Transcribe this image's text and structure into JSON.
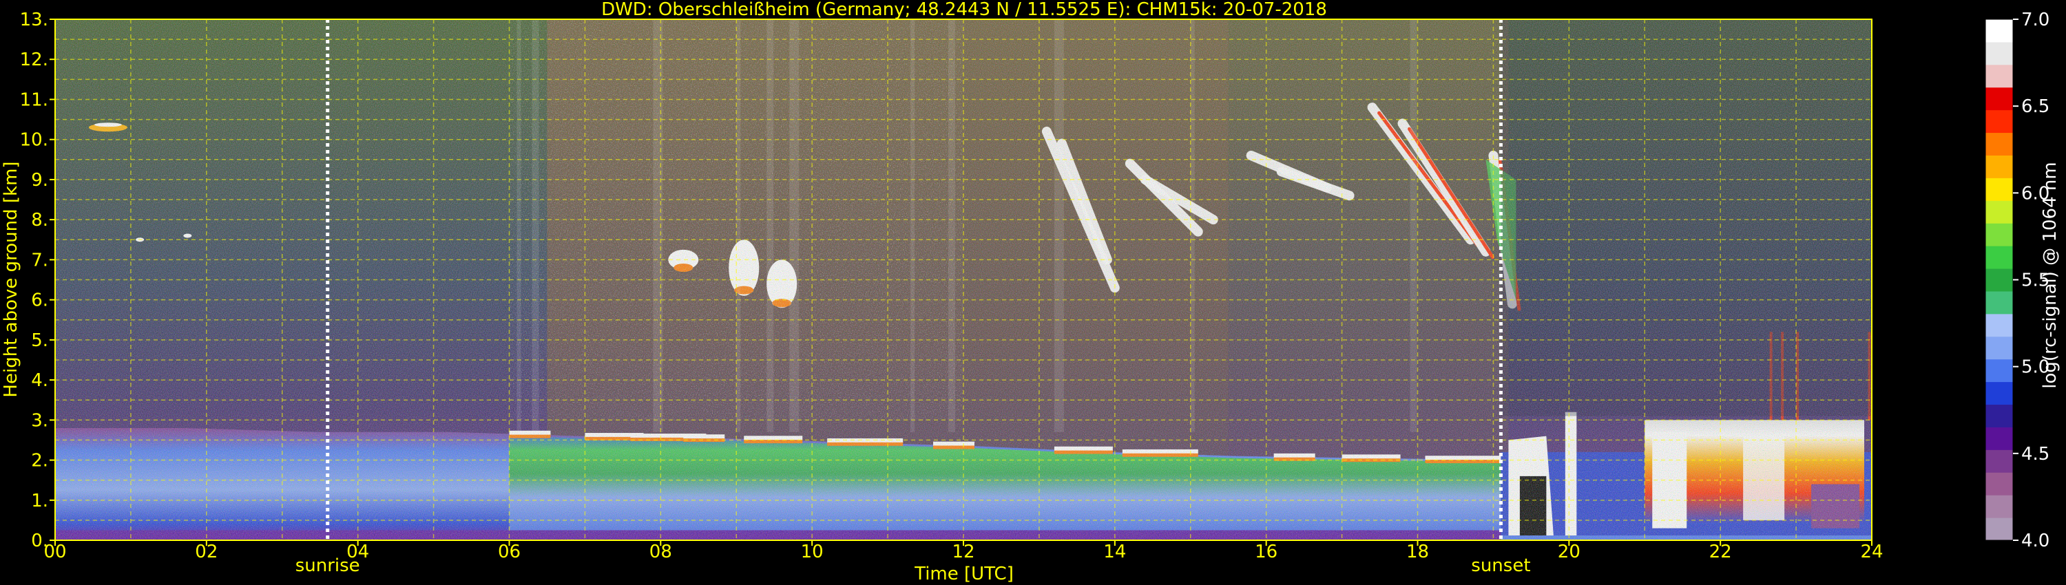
{
  "chart_data": {
    "type": "heatmap",
    "title": "DWD: Oberschleißheim (Germany; 48.2443 N / 11.5525 E):    CHM15k: 20-07-2018",
    "xlabel": "Time [UTC]",
    "ylabel": "Height above ground [km]",
    "xlim": [
      0,
      24
    ],
    "ylim": [
      0,
      13
    ],
    "x_ticks": [
      "00",
      "02",
      "04",
      "06",
      "08",
      "10",
      "12",
      "14",
      "16",
      "18",
      "20",
      "22",
      "24"
    ],
    "y_ticks": [
      "0.",
      "1.",
      "2.",
      "3.",
      "4.",
      "5.",
      "6.",
      "7.",
      "8.",
      "9.",
      "10.",
      "11.",
      "12.",
      "13."
    ],
    "grid": true,
    "background_color": "#000000",
    "axis_text_color": "#ffff00",
    "markers": [
      {
        "label": "sunrise",
        "time": 3.6
      },
      {
        "label": "sunset",
        "time": 19.1
      }
    ],
    "colorbar": {
      "label": "log(rc-signal) @ 1064 nm",
      "range": [
        4.0,
        7.0
      ],
      "ticks": [
        "4.0",
        "4.5",
        "5.0",
        "5.5",
        "6.0",
        "6.5",
        "7.0"
      ],
      "colors": [
        "#ad9bb8",
        "#a882a8",
        "#9a5a92",
        "#7a3a90",
        "#5a1298",
        "#2f1f9a",
        "#1f3fd8",
        "#4c78ee",
        "#84a6f3",
        "#a9c2f8",
        "#43c07a",
        "#27a83f",
        "#3bcd43",
        "#7ddf3c",
        "#c8ee28",
        "#ffe600",
        "#ffb000",
        "#ff7a00",
        "#ff2a00",
        "#e40000",
        "#eec2c2",
        "#e8e8e8",
        "#ffffff"
      ]
    },
    "features": [
      {
        "name": "boundary layer",
        "t_start": 0,
        "t_end": 19.1,
        "top_km": [
          2.8,
          2.8,
          2.7,
          2.7,
          2.6,
          2.55,
          2.45,
          2.35,
          2.2,
          2.1,
          2.05,
          2.0
        ]
      },
      {
        "name": "boundary layer top clouds",
        "t_start": 6,
        "t_end": 19,
        "height_km": 2.6
      },
      {
        "name": "cirrus",
        "t_start": 13,
        "t_end": 19.3,
        "height_range_km": [
          6.0,
          11.0
        ]
      },
      {
        "name": "mid-level clouds",
        "t_start": 8.2,
        "t_end": 10.5,
        "height_range_km": [
          5.8,
          7.4
        ]
      },
      {
        "name": "convective clouds",
        "t_start": 19.2,
        "t_end": 24,
        "height_range_km": [
          0,
          3.2
        ]
      },
      {
        "name": "elevated layer",
        "t_start": 0.4,
        "t_end": 1.0,
        "height_km": 10.3
      }
    ]
  }
}
